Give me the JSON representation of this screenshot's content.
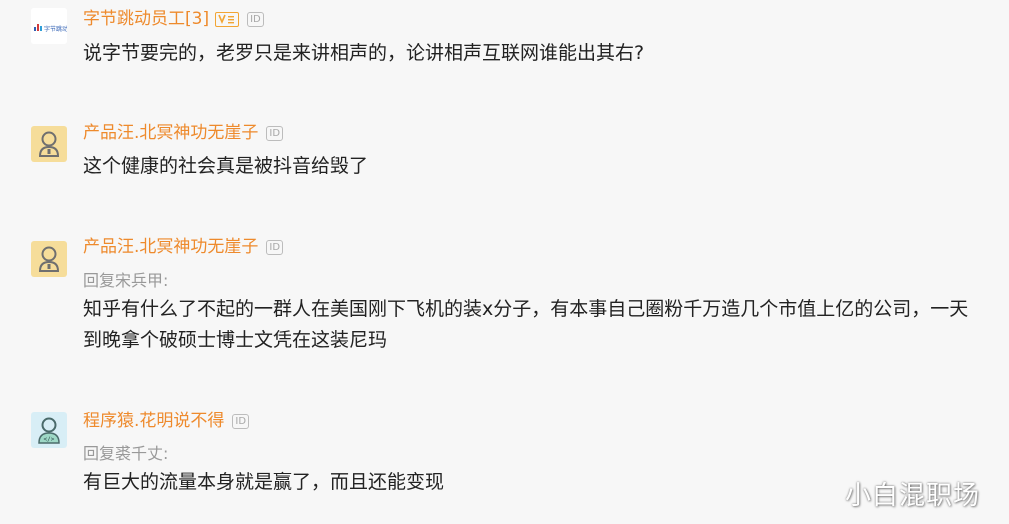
{
  "comments": [
    {
      "author": "字节跳动员工[3]",
      "avatar_text": "字节跳动",
      "verified_label": "V",
      "id_badge": "ID",
      "reply_to": "",
      "content": "说字节要完的，老罗只是来讲相声的，论讲相声互联网谁能出其右?"
    },
    {
      "author": "产品汪.北冥神功无崖子",
      "id_badge": "ID",
      "reply_to": "",
      "content": "这个健康的社会真是被抖音给毁了"
    },
    {
      "author": "产品汪.北冥神功无崖子",
      "id_badge": "ID",
      "reply_to": "回复宋兵甲:",
      "content": "知乎有什么了不起的一群人在美国刚下飞机的装x分子，有本事自己圈粉千万造几个市值上亿的公司，一天到晚拿个破硕士博士文凭在这装尼玛"
    },
    {
      "author": "程序猿.花明说不得",
      "id_badge": "ID",
      "reply_to": "回复裘千丈:",
      "content": "有巨大的流量本身就是赢了，而且还能变现"
    }
  ],
  "watermark": "小白混职场",
  "colors": {
    "author": "#ee8a2c",
    "reply": "#999999",
    "content": "#222222",
    "background": "#f7f7f7"
  }
}
